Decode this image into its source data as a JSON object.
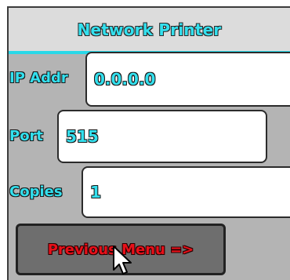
{
  "header": {
    "title": "Network Printer"
  },
  "fields": {
    "ip": {
      "label": "IP Addr",
      "value": "0.0.0.0"
    },
    "port": {
      "label": "Port",
      "value": "515"
    },
    "copies": {
      "label": "Copies",
      "value": "1"
    }
  },
  "button": {
    "label": "Previous Menu =>"
  },
  "colors": {
    "accent": "#33e0ee",
    "button_text": "#e8101a",
    "panel": "#b4b4b4"
  },
  "icons": {
    "cursor": "mouse-pointer-icon"
  }
}
